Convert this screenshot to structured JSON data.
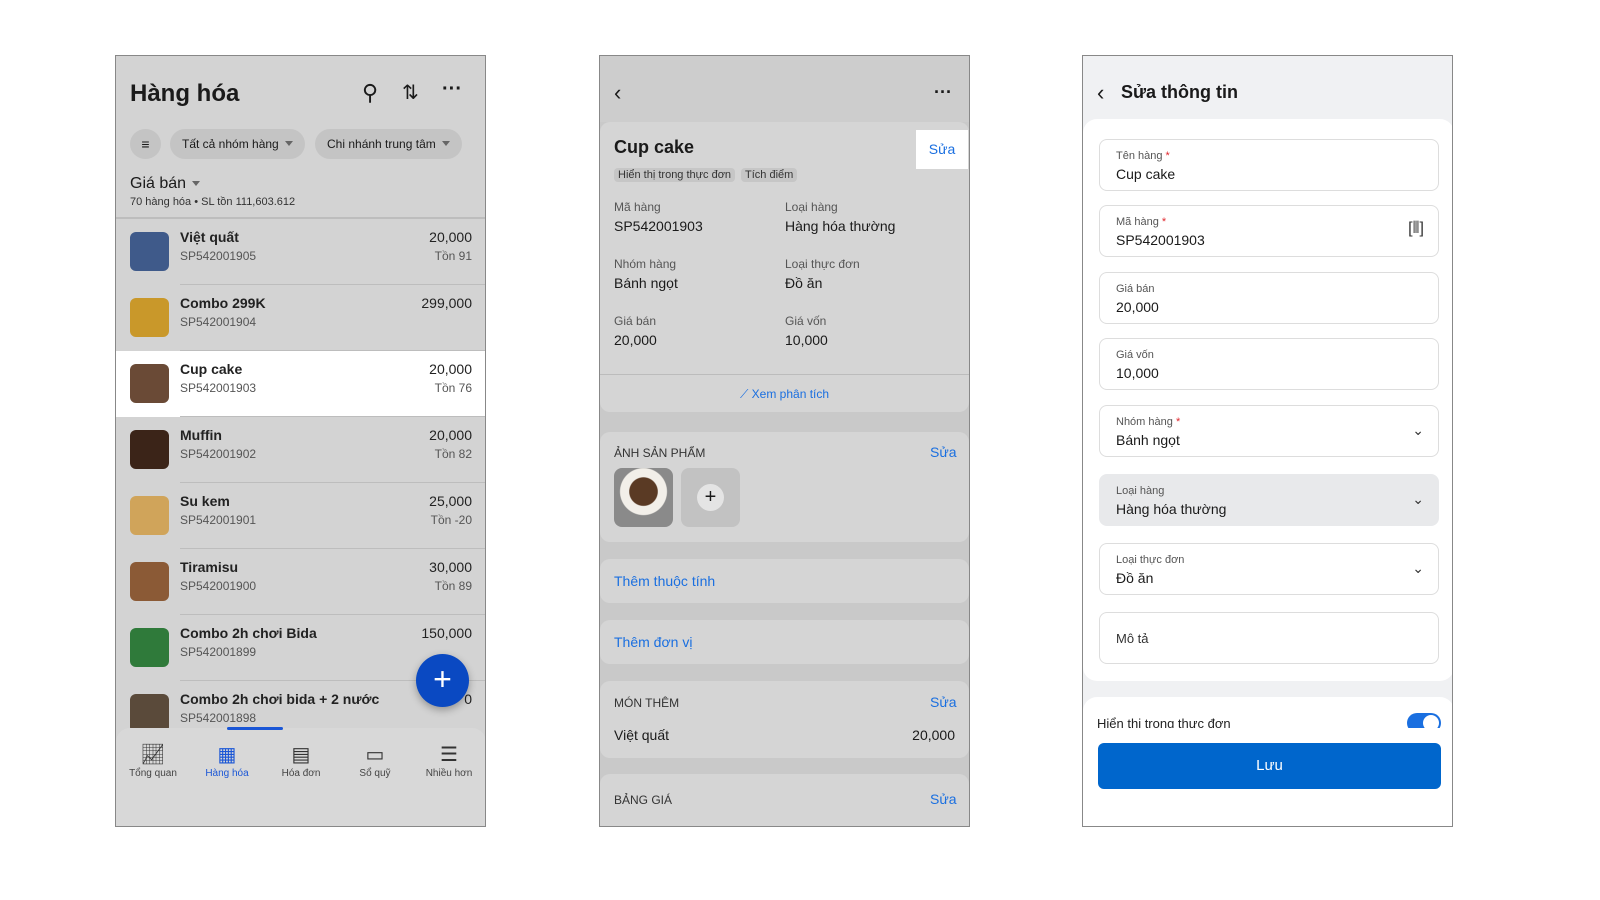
{
  "list_screen": {
    "title": "Hàng hóa",
    "filters": [
      "Tất cả nhóm hàng",
      "Chi nhánh trung tâm"
    ],
    "price_label": "Giá bán",
    "summary": "70 hàng hóa • SL tồn 111,603.612",
    "items": [
      {
        "name": "Việt quất",
        "code": "SP542001905",
        "price": "20,000",
        "stock": "Tồn 91"
      },
      {
        "name": "Combo 299K",
        "code": "SP542001904",
        "price": "299,000",
        "stock": ""
      },
      {
        "name": "Cup cake",
        "code": "SP542001903",
        "price": "20,000",
        "stock": "Tồn 76"
      },
      {
        "name": "Muffin",
        "code": "SP542001902",
        "price": "20,000",
        "stock": "Tồn 82"
      },
      {
        "name": "Su kem",
        "code": "SP542001901",
        "price": "25,000",
        "stock": "Tồn -20"
      },
      {
        "name": "Tiramisu",
        "code": "SP542001900",
        "price": "30,000",
        "stock": "Tồn 89"
      },
      {
        "name": "Combo 2h chơi Bida",
        "code": "SP542001899",
        "price": "150,000",
        "stock": ""
      },
      {
        "name": "Combo 2h chơi bida + 2 nước",
        "code": "SP542001898",
        "price": "0",
        "stock": ""
      }
    ],
    "nav": [
      "Tổng quan",
      "Hàng hóa",
      "Hóa đơn",
      "Sổ quỹ",
      "Nhiều hơn"
    ]
  },
  "detail_screen": {
    "name": "Cup cake",
    "edit": "Sửa",
    "tags": [
      "Hiển thị trong thực đơn",
      "Tích điểm"
    ],
    "fields": [
      {
        "label": "Mã hàng",
        "value": "SP542001903"
      },
      {
        "label": "Loại hàng",
        "value": "Hàng hóa thường"
      },
      {
        "label": "Nhóm hàng",
        "value": "Bánh ngọt"
      },
      {
        "label": "Loại thực đơn",
        "value": "Đồ ăn"
      },
      {
        "label": "Giá bán",
        "value": "20,000"
      },
      {
        "label": "Giá vốn",
        "value": "10,000"
      }
    ],
    "analysis_link": "Xem phân tích",
    "images_title": "ẢNH SẢN PHẨM",
    "add_attribute": "Thêm thuộc tính",
    "add_unit": "Thêm đơn vị",
    "addons_title": "MÓN THÊM",
    "addon": {
      "name": "Việt quất",
      "price": "20,000"
    },
    "pricebook_title": "BẢNG GIÁ"
  },
  "edit_screen": {
    "title": "Sửa thông tin",
    "fields": [
      {
        "label": "Tên hàng",
        "required": "*",
        "value": "Cup cake"
      },
      {
        "label": "Mã hàng",
        "required": "*",
        "value": "SP542001903"
      },
      {
        "label": "Giá bán",
        "required": "",
        "value": "20,000"
      },
      {
        "label": "Giá vốn",
        "required": "",
        "value": "10,000"
      },
      {
        "label": "Nhóm hàng",
        "required": "*",
        "value": "Bánh ngọt"
      },
      {
        "label": "Loại hàng",
        "required": "",
        "value": "Hàng hóa thường"
      },
      {
        "label": "Loại thực đơn",
        "required": "",
        "value": "Đồ ăn"
      }
    ],
    "description_placeholder": "Mô tả",
    "show_in_menu": "Hiển thị trong thực đơn",
    "save": "Lưu"
  }
}
